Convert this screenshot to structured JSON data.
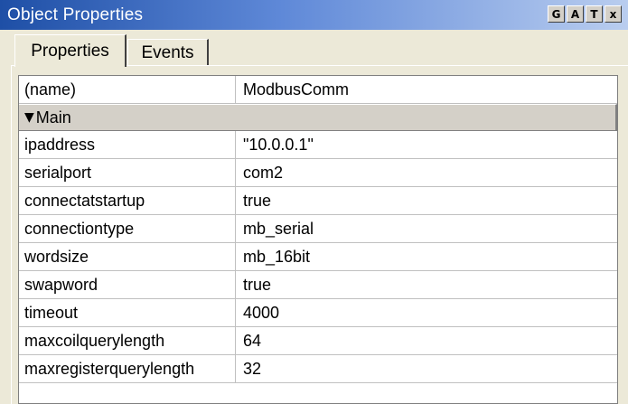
{
  "window": {
    "title": "Object Properties",
    "buttons": [
      "G",
      "A",
      "T",
      "x"
    ]
  },
  "tabs": [
    {
      "label": "Properties",
      "active": true
    },
    {
      "label": "Events",
      "active": false
    }
  ],
  "grid": {
    "top_row": {
      "key": "(name)",
      "value": "ModbusComm"
    },
    "section": {
      "label": "Main",
      "icon": "triangle-down-icon",
      "expanded": true
    },
    "rows": [
      {
        "key": "ipaddress",
        "value": "\"10.0.0.1\""
      },
      {
        "key": "serialport",
        "value": "com2"
      },
      {
        "key": "connectatstartup",
        "value": "true"
      },
      {
        "key": "connectiontype",
        "value": "mb_serial"
      },
      {
        "key": "wordsize",
        "value": "mb_16bit"
      },
      {
        "key": "swapword",
        "value": "true"
      },
      {
        "key": "timeout",
        "value": "4000"
      },
      {
        "key": "maxcoilquerylength",
        "value": "64"
      },
      {
        "key": "maxregisterquerylength",
        "value": "32"
      }
    ]
  },
  "colors": {
    "titlebar_start": "#1e4fa6",
    "titlebar_end": "#b9cdef",
    "panel_bg": "#ece9d8",
    "section_bg": "#d4d0c8"
  }
}
